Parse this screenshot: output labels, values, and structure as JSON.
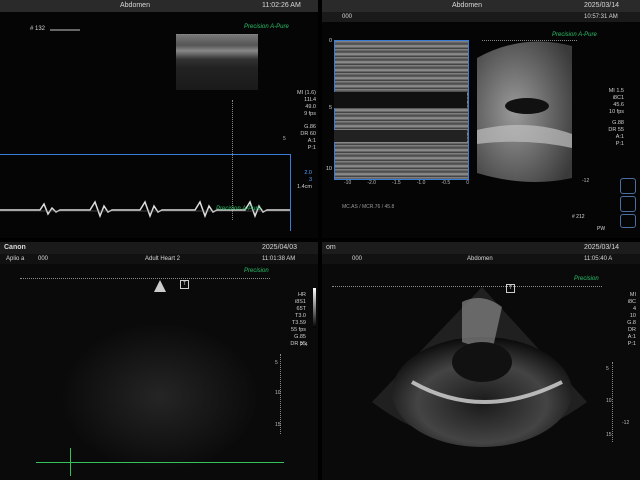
{
  "q1": {
    "title": "Abdomen",
    "time": "11:02:26 AM",
    "frame": "# 132",
    "brand": "Precision",
    "brand2": "A-Pure",
    "params": [
      "MI (1.6)",
      "11L4",
      "49.0",
      "9 fps",
      "G.86",
      "DR 60",
      "A:1",
      "P:1"
    ],
    "depth_5": "5",
    "speed": [
      "2.0",
      "3",
      "1.4cm"
    ]
  },
  "q2": {
    "title": "Abdomen",
    "date": "2025/03/14",
    "time": "10:57:31 AM",
    "sub": "000",
    "brand": "Precision",
    "brand2": "A-Pure",
    "params": [
      "MI 1.5",
      "i8C1",
      "45.6",
      "10 fps",
      "G.88",
      "DR 55",
      "A:1",
      "P:1"
    ],
    "axis_labels": [
      "-10",
      "-2.0",
      "-1.5",
      "-1.0",
      "-0.5",
      "0"
    ],
    "left_labels": [
      "0",
      "5",
      "10"
    ],
    "right_depth": "-12",
    "footer": "MC.AS / MCR.76 / 45.8",
    "frame": "# 212",
    "pw": "PW"
  },
  "q3": {
    "maker": "Canon",
    "model": "Aplio a",
    "title": "Adult Heart 2",
    "date": "2025/04/03",
    "time": "11:01:38 AM",
    "sub": "000",
    "brand": "Precision",
    "params": [
      "HR",
      "i8S1",
      "65T",
      "T3.0",
      "T3.59",
      "55 fps",
      "G.85",
      "DR 55"
    ],
    "p_label": "P:4",
    "depths": [
      "5",
      "10",
      "15"
    ]
  },
  "q4": {
    "title": "Abdomen",
    "date": "2025/03/14",
    "time": "11:05:40 A",
    "sub": "000",
    "brand": "Precision",
    "params": [
      "MI",
      "i8C",
      "4",
      "10",
      "G.8",
      "DR",
      "A:1",
      "P:1"
    ],
    "depths": [
      "5",
      "10",
      "15"
    ],
    "right_depth": "-12",
    "corner": "om"
  },
  "colors": {
    "brand": "#29c06a",
    "roi": "#3a7bd5",
    "cursor": "#36c25a"
  }
}
